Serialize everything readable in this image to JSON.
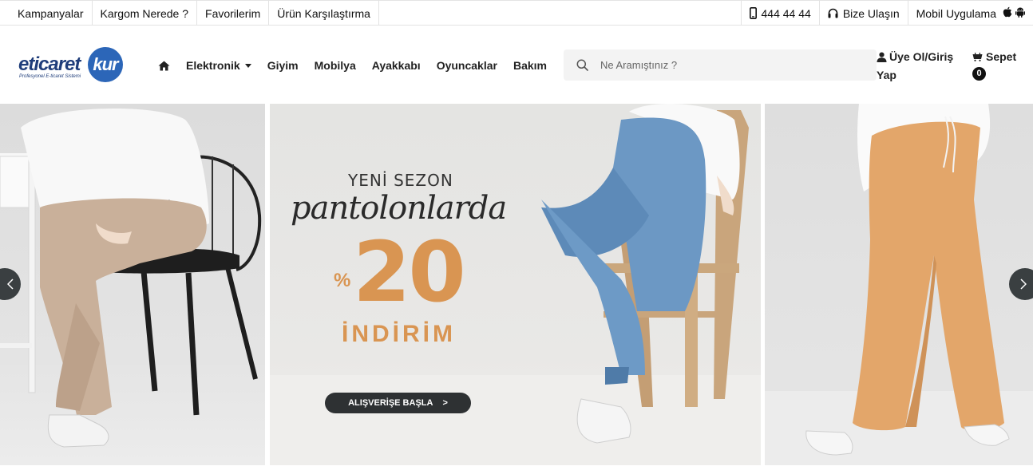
{
  "topbar": {
    "left_links": [
      "Kampanyalar",
      "Kargom Nerede ?",
      "Favorilerim",
      "Ürün Karşılaştırma"
    ],
    "phone": "444 44 44",
    "contact": "Bize Ulaşın",
    "mobile_app": "Mobil Uygulama"
  },
  "logo": {
    "word": "eticaret",
    "badge": "kur",
    "tagline": "Profesyonel E-ticaret Sistemi"
  },
  "nav": {
    "items": [
      "Elektronik",
      "Giyim",
      "Mobilya",
      "Ayakkabı",
      "Oyuncaklar",
      "Bakım"
    ]
  },
  "search": {
    "placeholder": "Ne Aramıştınız ?"
  },
  "account": {
    "label": "Üye Ol/Giriş Yap"
  },
  "cart": {
    "label": "Sepet",
    "count": "0"
  },
  "hero": {
    "line1": "YENİ SEZON",
    "line2": "pantolonlarda",
    "percent_sign": "%",
    "discount": "20",
    "line3": "İNDİRİM",
    "cta": "ALIŞVERİŞE BAŞLA",
    "cta_arrow": ">"
  },
  "colors": {
    "accent": "#d99552",
    "cta_bg": "#2e3133",
    "logo_blue": "#2c66b8"
  },
  "icons": {
    "phone": "phone-icon",
    "headset": "headset-icon",
    "apple": "apple-icon",
    "android": "android-icon",
    "home": "home-icon",
    "search": "search-icon",
    "user": "user-icon",
    "cart": "cart-icon",
    "prev": "chevron-left-icon",
    "next": "chevron-right-icon"
  }
}
